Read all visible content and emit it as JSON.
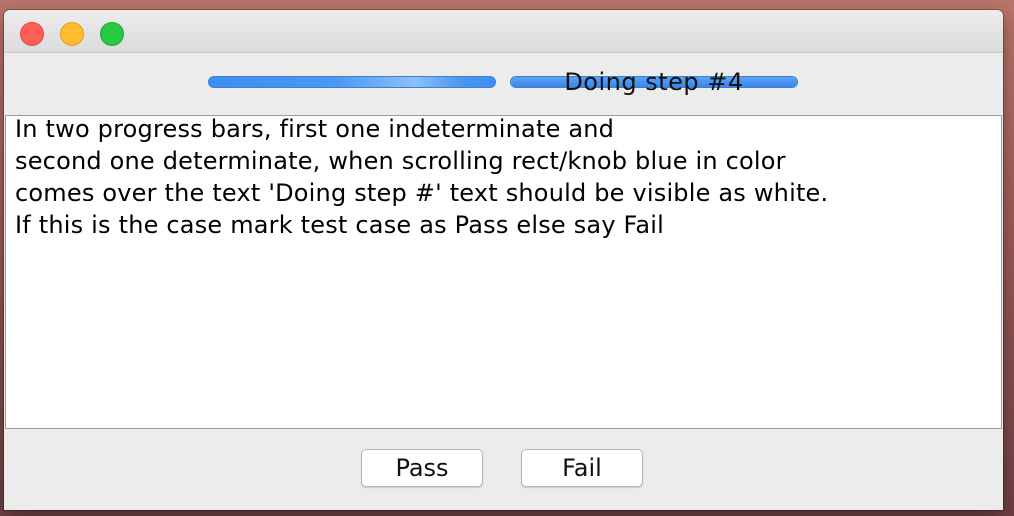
{
  "window": {
    "controls": [
      {
        "name": "close",
        "color": "#fe5f57"
      },
      {
        "name": "minimize",
        "color": "#febc2e"
      },
      {
        "name": "maximize",
        "color": "#28c840"
      }
    ]
  },
  "progress": {
    "indeterminate": {
      "mode": "indeterminate"
    },
    "determinate": {
      "mode": "determinate",
      "string": "Doing step #4",
      "value_fraction": 1.0
    },
    "accent_color": "#3d8ef0"
  },
  "instructions": [
    "In two progress bars, first one indeterminate and",
    "second one determinate, when scrolling rect/knob blue in color",
    "comes over the text 'Doing step #' text should be visible as white.",
    "If this is the case mark test case as Pass else say Fail"
  ],
  "buttons": {
    "pass_label": "Pass",
    "fail_label": "Fail"
  }
}
